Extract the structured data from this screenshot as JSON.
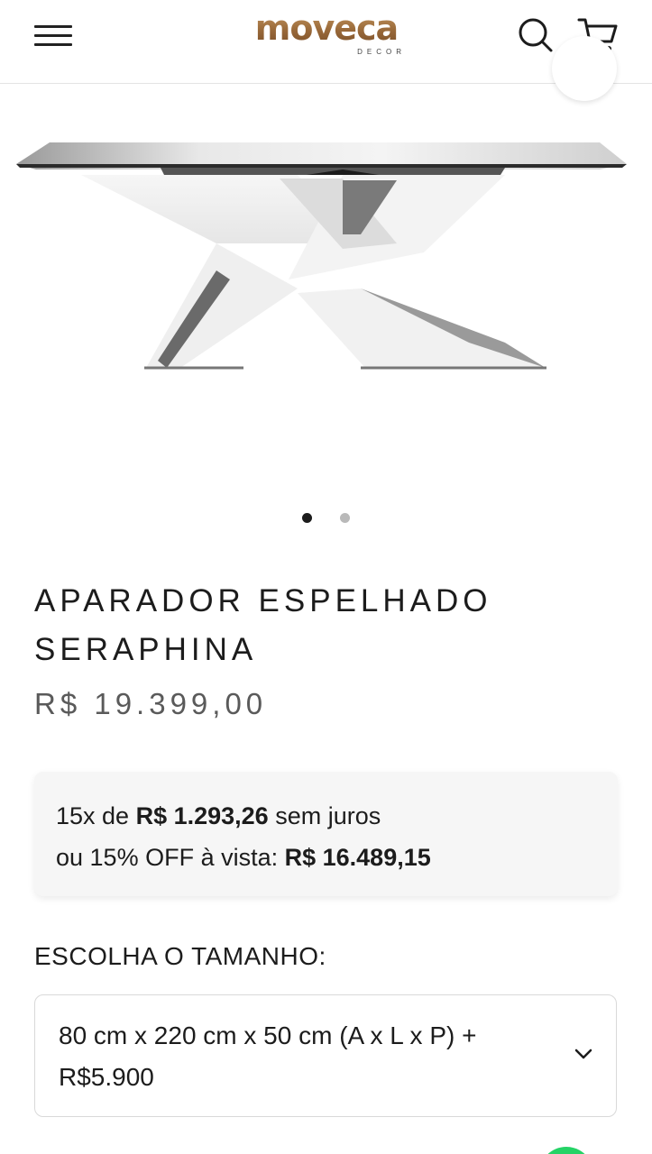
{
  "header": {
    "logo_text": "moveca",
    "logo_subtext": "DECOR",
    "menu_icon": "hamburger-menu-icon",
    "search_icon": "search-icon",
    "cart_icon": "cart-icon"
  },
  "gallery": {
    "image_alt": "Aparador espelhado Seraphina",
    "slide_count": 2,
    "active_slide": 1
  },
  "product": {
    "title": "APARADOR ESPELHADO SERAPHINA",
    "price": "R$ 19.399,00"
  },
  "installments": {
    "line1_prefix": "15x de ",
    "line1_amount": "R$ 1.293,26",
    "line1_suffix": " sem juros",
    "line2_prefix": "ou 15% OFF à vista: ",
    "line2_amount": "R$ 16.489,15"
  },
  "size": {
    "label": "ESCOLHA O TAMANHO:",
    "selected": "80 cm x 220 cm x 50 cm (A x L x P) + R$5.900",
    "chevron_icon": "chevron-down-icon"
  },
  "colors": {
    "logo_gold": "#b0804c",
    "text_dark": "#1c1c1c",
    "price_gray": "#5a5a5a",
    "panel_bg": "#f6f6f6",
    "whatsapp_green": "#25d366"
  }
}
